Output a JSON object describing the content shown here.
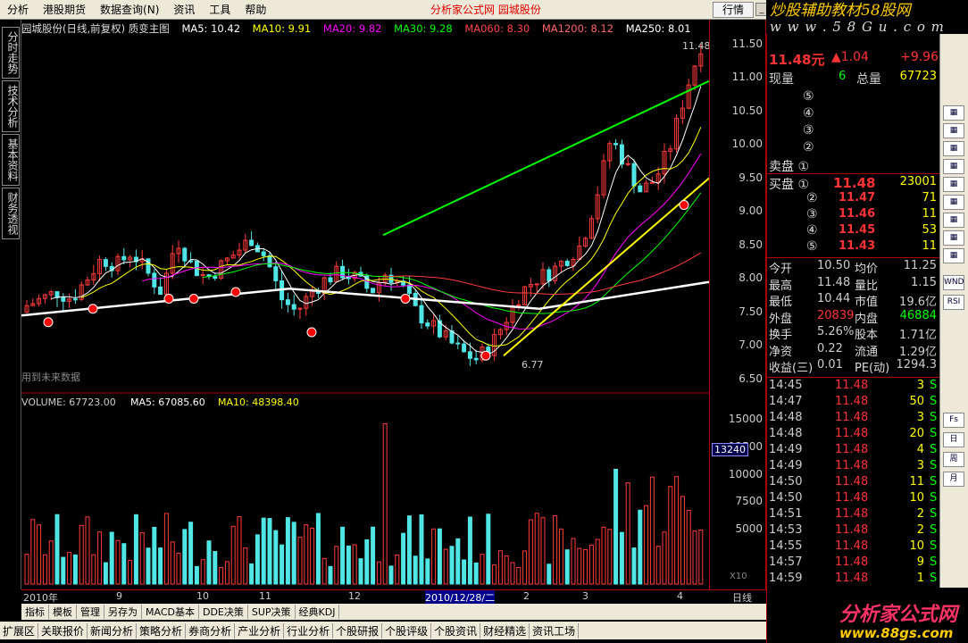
{
  "menu": {
    "items": [
      "分析",
      "港股期货",
      "数据查询(N)",
      "资讯",
      "工具",
      "帮助"
    ],
    "center_title": "分析家公式网  园城股份",
    "hq_button": "行情"
  },
  "brand": {
    "text": "炒股辅助教材58股网",
    "url": "w w w . 5 8 G u . c o m"
  },
  "left_tabs": [
    "分时走势",
    "技术分析",
    "基本资料",
    "财务透视"
  ],
  "chart_header": {
    "name": "园城股份(日线,前复权) 质变主图",
    "ma5": "MA5: 10.42",
    "ma10": "MA10: 9.91",
    "ma20": "MA20: 9.82",
    "ma30": "MA30: 9.28",
    "ma60": "MA060: 8.30",
    "ma120": "MA1200: 8.12",
    "ma250": "MA250: 8.01",
    "future_note": "用到未来数据",
    "high_label": "11.48",
    "low_label": "6.77"
  },
  "vol_header": {
    "volume": "VOLUME: 67723.00",
    "ma5": "MA5: 67085.60",
    "ma10": "MA10: 48398.40",
    "badge": "13240",
    "multiplier": "X10"
  },
  "price_ticks": [
    "11.50",
    "11.00",
    "10.50",
    "10.00",
    "9.50",
    "9.00",
    "8.50",
    "8.00",
    "7.50",
    "7.00",
    "6.50"
  ],
  "vol_ticks": [
    "15000",
    "12500",
    "10000",
    "7500",
    "5000"
  ],
  "colors": {
    "up": "#ff3c3c",
    "down": "#50e6e6",
    "ma5": "#ffffff",
    "ma10": "#ffff00",
    "ma20": "#ff00ff",
    "ma30": "#00ff00",
    "ma60": "#ff3c3c",
    "ma120": "#ff6464",
    "ma250": "#ffffff",
    "accent": "#ff0000",
    "green": "#00ff00"
  },
  "dates": {
    "items": [
      "2010年",
      "9",
      "10",
      "11",
      "12",
      "2010/12/28/二",
      "2",
      "3",
      "4"
    ],
    "period": "日线"
  },
  "chart_data": {
    "type": "candlestick",
    "title": "园城股份(日线,前复权)",
    "ylim": [
      6.4,
      11.6
    ],
    "annotations": [
      {
        "x": "high",
        "y": 11.48,
        "text": "11.48"
      },
      {
        "x": "low",
        "y": 6.77,
        "text": "6.77"
      }
    ],
    "series": [
      {
        "name": "MA5",
        "last": 10.42
      },
      {
        "name": "MA10",
        "last": 9.91
      },
      {
        "name": "MA20",
        "last": 9.82
      },
      {
        "name": "MA30",
        "last": 9.28
      },
      {
        "name": "MA060",
        "last": 8.3
      },
      {
        "name": "MA1200",
        "last": 8.12
      },
      {
        "name": "MA250",
        "last": 8.01
      }
    ],
    "volume": {
      "last": 67723.0,
      "ma5": 67085.6,
      "ma10": 48398.4,
      "ylim": [
        0,
        16000
      ]
    }
  },
  "quote": {
    "price": "11.48",
    "unit": "元",
    "change": "▲1.04",
    "pct": "+9.96",
    "xianliang_label": "现量",
    "xianliang": "6",
    "zongliang_label": "总量",
    "zongliang": "67723"
  },
  "sell": [
    {
      "label": "⑤",
      "price": "",
      "vol": ""
    },
    {
      "label": "④",
      "price": "",
      "vol": ""
    },
    {
      "label": "③",
      "price": "",
      "vol": ""
    },
    {
      "label": "②",
      "price": "",
      "vol": ""
    },
    {
      "label": "卖盘 ①",
      "price": "",
      "vol": ""
    }
  ],
  "buy": [
    {
      "label": "买盘 ①",
      "price": "11.48",
      "vol": "23001"
    },
    {
      "label": "②",
      "price": "11.47",
      "vol": "71"
    },
    {
      "label": "③",
      "price": "11.46",
      "vol": "11"
    },
    {
      "label": "④",
      "price": "11.45",
      "vol": "53"
    },
    {
      "label": "⑤",
      "price": "11.43",
      "vol": "11"
    }
  ],
  "stats": [
    {
      "l1": "今开",
      "v1": "10.50",
      "l2": "均价",
      "v2": "11.25"
    },
    {
      "l1": "最高",
      "v1": "11.48",
      "l2": "量比",
      "v2": "1.15"
    },
    {
      "l1": "最低",
      "v1": "10.44",
      "l2": "市值",
      "v2": "19.6亿"
    },
    {
      "l1": "外盘",
      "v1": "20839",
      "l2": "内盘",
      "v2": "46884"
    },
    {
      "l1": "换手",
      "v1": "5.26%",
      "l2": "股本",
      "v2": "1.71亿"
    },
    {
      "l1": "净资",
      "v1": "0.22",
      "l2": "流通",
      "v2": "1.29亿"
    },
    {
      "l1": "收益(三)",
      "v1": "0.01",
      "l2": "PE(动)",
      "v2": "1294.3"
    }
  ],
  "ticks_list": [
    {
      "t": "14:45",
      "p": "11.48",
      "v": "3",
      "s": "S"
    },
    {
      "t": "14:47",
      "p": "11.48",
      "v": "50",
      "s": "S"
    },
    {
      "t": "14:48",
      "p": "11.48",
      "v": "3",
      "s": "S"
    },
    {
      "t": "14:48",
      "p": "11.48",
      "v": "20",
      "s": "S"
    },
    {
      "t": "14:49",
      "p": "11.48",
      "v": "4",
      "s": "S"
    },
    {
      "t": "14:49",
      "p": "11.48",
      "v": "3",
      "s": "S"
    },
    {
      "t": "14:50",
      "p": "11.48",
      "v": "11",
      "s": "S"
    },
    {
      "t": "14:50",
      "p": "11.48",
      "v": "10",
      "s": "S"
    },
    {
      "t": "14:51",
      "p": "11.48",
      "v": "2",
      "s": "S"
    },
    {
      "t": "14:53",
      "p": "11.48",
      "v": "2",
      "s": "S"
    },
    {
      "t": "14:55",
      "p": "11.48",
      "v": "10",
      "s": "S"
    },
    {
      "t": "14:57",
      "p": "11.48",
      "v": "9",
      "s": "S"
    },
    {
      "t": "14:59",
      "p": "11.48",
      "v": "1",
      "s": "S"
    }
  ],
  "tabs1": [
    "指标",
    "模板",
    "管理",
    "另存为",
    "MACD基本",
    "DDE决策",
    "SUP决策",
    "经典KDJ"
  ],
  "tabs2": [
    "扩展区",
    "关联报价",
    "新闻分析",
    "策略分析",
    "券商分析",
    "产业分析",
    "行业分析",
    "个股研报",
    "个股评级",
    "个股资讯",
    "财经精选",
    "资讯工场"
  ],
  "tools": [
    "WND",
    "RSI",
    "Fs",
    "日",
    "周",
    "月"
  ],
  "logo": {
    "name": "分析家公式网",
    "url": "www.88gs.com"
  }
}
